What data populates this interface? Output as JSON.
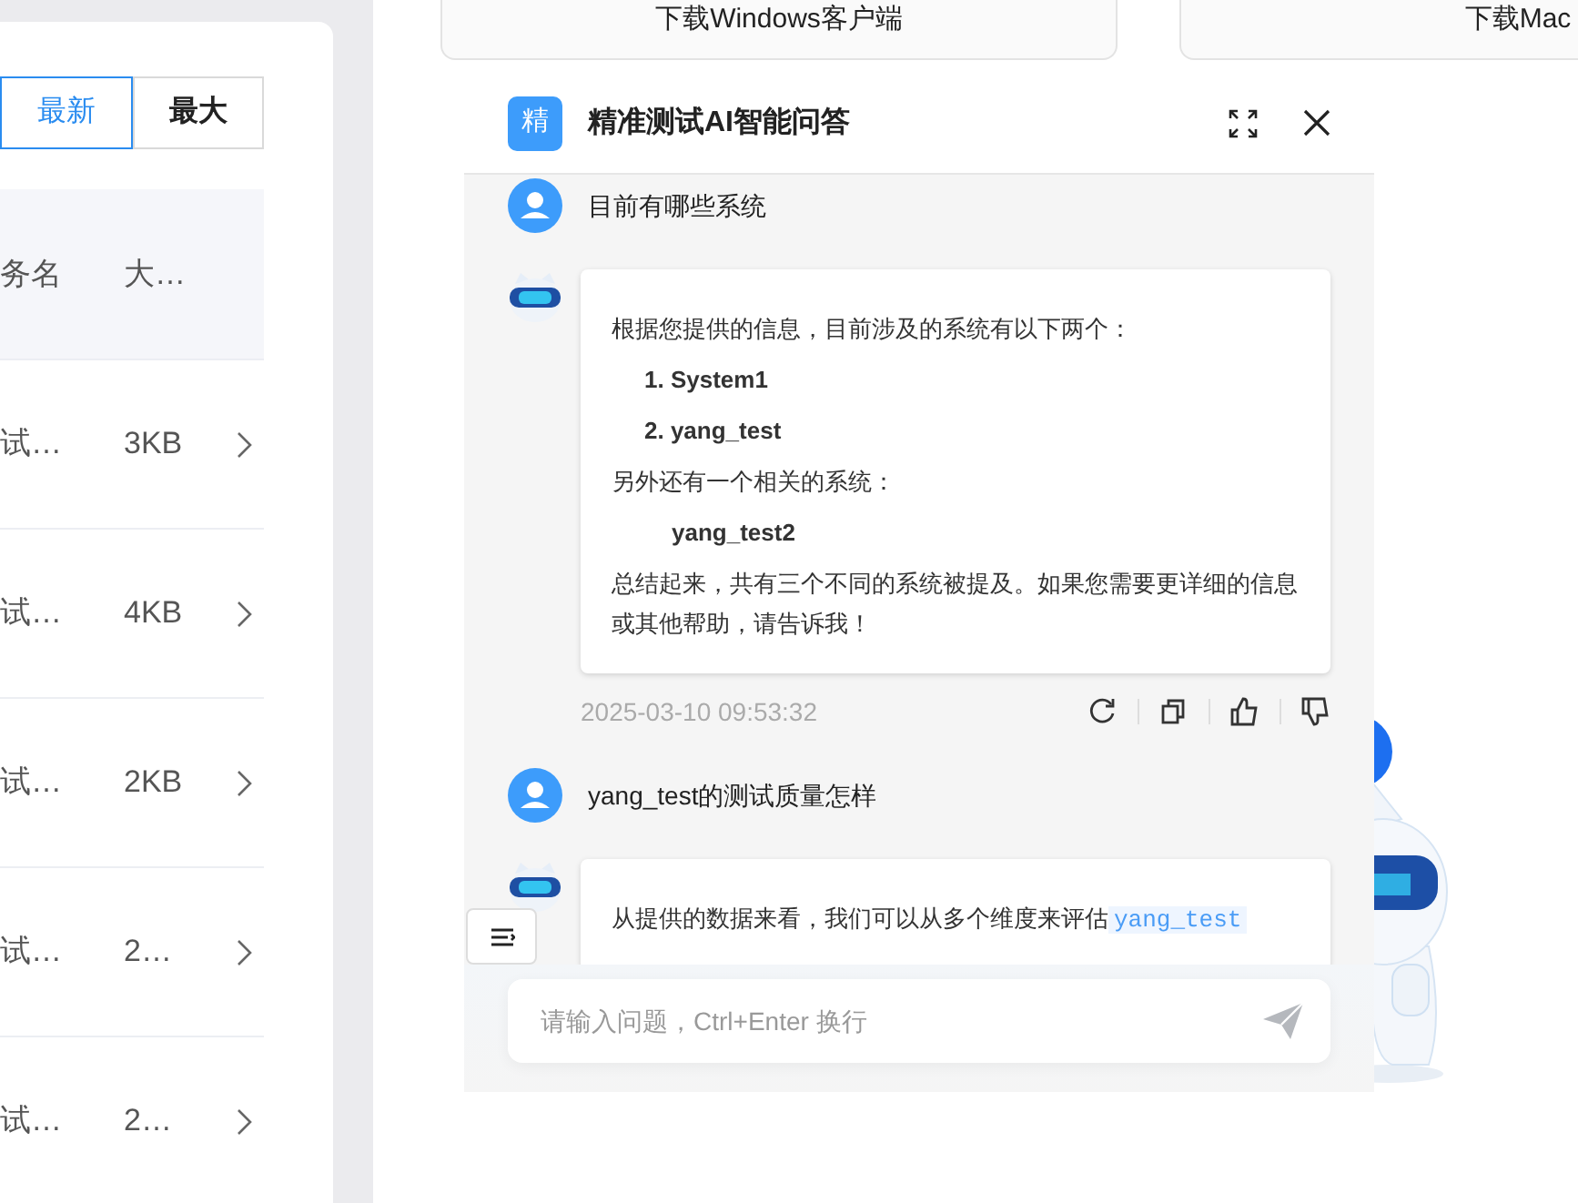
{
  "download_cards": [
    {
      "label": "下载Windows客户端"
    },
    {
      "label": "下载Mac"
    }
  ],
  "sort_tabs": [
    {
      "label": "最新",
      "selected": true
    },
    {
      "label": "最大",
      "selected": false
    }
  ],
  "table": {
    "columns": [
      "务名",
      "大…"
    ],
    "rows": [
      [
        "试…",
        "3KB"
      ],
      [
        "试…",
        "4KB"
      ],
      [
        "试…",
        "2KB"
      ],
      [
        "试…",
        "2…"
      ],
      [
        "试…",
        "2…"
      ]
    ]
  },
  "chat": {
    "logo": "精",
    "title": "精准测试AI智能问答",
    "messages": [
      {
        "kind": "user",
        "text": "目前有哪些系统"
      },
      {
        "kind": "bot",
        "time": "2025-03-10 09:53:32",
        "blocks": [
          {
            "kind": "para",
            "text": "根据您提供的信息，目前涉及的系统有以下两个："
          },
          {
            "kind": "item",
            "number": "1.",
            "text": "System1"
          },
          {
            "kind": "item",
            "number": "2.",
            "text": "yang_test"
          },
          {
            "kind": "para",
            "text": "另外还有一个相关的系统："
          },
          {
            "kind": "indent",
            "text": "yang_test2"
          },
          {
            "kind": "para",
            "text": "总结起来，共有三个不同的系统被提及。如果您需要更详细的信息或其他帮助，请告诉我！"
          }
        ]
      },
      {
        "kind": "user",
        "text": "yang_test的测试质量怎样"
      },
      {
        "kind": "bot",
        "blocks": [
          {
            "kind": "para",
            "text": "从提供的数据来看，我们可以从多个维度来评估",
            "code": "yang_test"
          }
        ]
      }
    ],
    "input": {
      "placeholder": "请输入问题，Ctrl+Enter 换行"
    }
  }
}
